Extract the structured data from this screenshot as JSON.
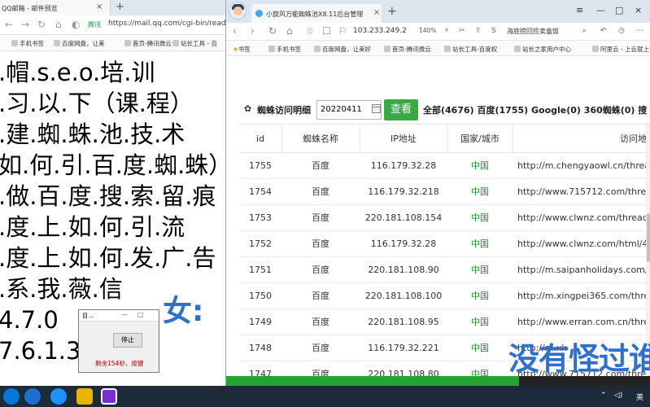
{
  "left_browser": {
    "tab_title": "QQ邮箱 - 邮件预览",
    "url_secure": "腾讯",
    "url": "https://mail.qq.com/cgi-bin/read",
    "bookmarks": [
      "手机书签",
      "百度网盘，让美",
      "首页-腾讯微云",
      "站长工具 - 百"
    ],
    "page_lines": [
      ".帽.s.e.o.培.训",
      ".习.以.下（课.程）",
      ".建.蜘.蛛.池.技.术",
      "如.何.引.百.度.蜘.蛛）",
      ".做.百.度.搜.索.留.痕",
      ".度.上.如.何.引.流",
      ".度.上.如.何.发.广.告",
      ".系.我.薇.信",
      "4.7.0",
      "7.6.1.3"
    ],
    "overlay_char": "女:"
  },
  "mini_dialog": {
    "title": "目...",
    "button": "停止",
    "status": "剩余154秒，按键"
  },
  "right_browser": {
    "tab_title": "小旋风万能蜘蛛池X8.11后台管理",
    "url": "103.233.249.2",
    "zoom": "140%",
    "search_hint": "海底捞回应卖盒饭",
    "bookmarks": [
      "书签",
      "手机书签",
      "百度网盘，让美好",
      "首页-腾讯微云",
      "站长工具-百度权",
      "站长之家用户中心",
      "阿里云 - 上云就上"
    ],
    "toolbar": {
      "title": "蜘蛛访问明细",
      "date": "20220411",
      "query_button": "查看",
      "stats": "全部(4676)  百度(1755)  Google(0)  360蜘蛛(0)  搜"
    },
    "table": {
      "headers": [
        "id",
        "蜘蛛名称",
        "IP地址",
        "国家/城市",
        "访问地"
      ],
      "rows": [
        {
          "id": "1755",
          "name": "百度",
          "ip": "116.179.32.28",
          "country": "中国",
          "url": "http://m.chengyaowl.cn/threa"
        },
        {
          "id": "1754",
          "name": "百度",
          "ip": "116.179.32.218",
          "country": "中国",
          "url": "http://www.715712.com/thre"
        },
        {
          "id": "1753",
          "name": "百度",
          "ip": "220.181.108.154",
          "country": "中国",
          "url": "http://www.clwnz.com/thread/"
        },
        {
          "id": "1752",
          "name": "百度",
          "ip": "116.179.32.28",
          "country": "中国",
          "url": "http://www.clwnz.com/html/4"
        },
        {
          "id": "1751",
          "name": "百度",
          "ip": "220.181.108.90",
          "country": "中国",
          "url": "http://m.saipanholidays.com/"
        },
        {
          "id": "1750",
          "name": "百度",
          "ip": "220.181.108.100",
          "country": "中国",
          "url": "http://m.xingpei365.com/thre"
        },
        {
          "id": "1749",
          "name": "百度",
          "ip": "220.181.108.95",
          "country": "中国",
          "url": "http://www.erran.com.cn/threa"
        },
        {
          "id": "1748",
          "name": "百度",
          "ip": "116.179.32.221",
          "country": "中国",
          "url": "http://m.xk"
        },
        {
          "id": "1747",
          "name": "百度",
          "ip": "220.181.108.80",
          "country": "中国",
          "url": "http://www.715712.com/thre"
        }
      ]
    },
    "watermark": "没有怪过谁"
  },
  "taskbar": {
    "ime": "英",
    "colors": {
      "green": "#23a32f",
      "blue": "#2e6fd0"
    }
  }
}
